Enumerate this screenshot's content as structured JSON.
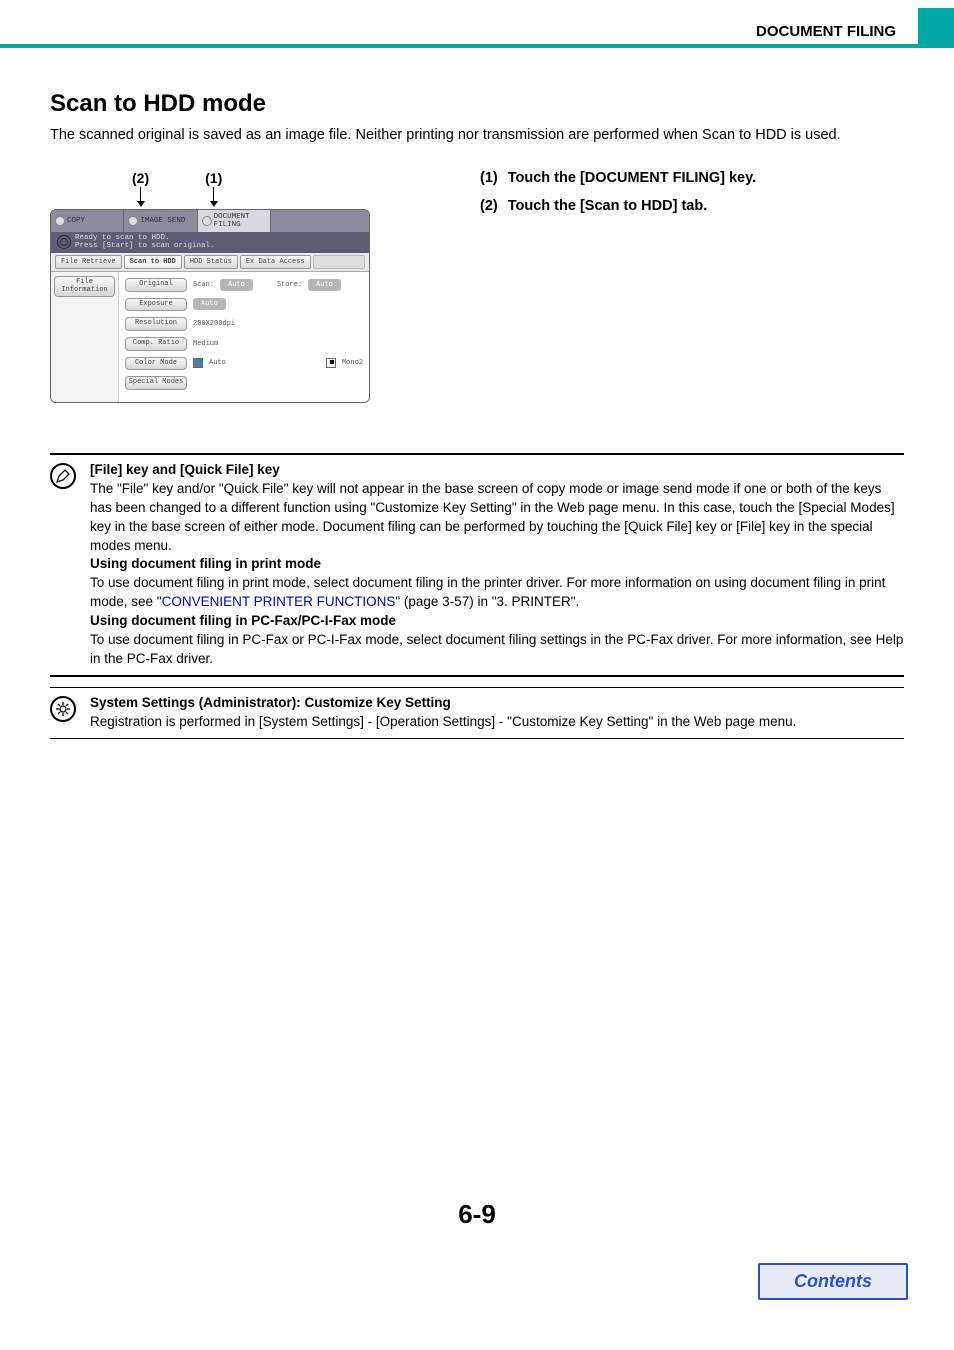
{
  "header": {
    "section_title": "DOCUMENT FILING"
  },
  "heading": "Scan to HDD mode",
  "lead": "The scanned original is saved as an image file. Neither printing nor transmission are performed when Scan to HDD is used.",
  "callouts": {
    "c1": "(1)",
    "c2": "(2)"
  },
  "panel": {
    "mode_tabs": {
      "copy": "COPY",
      "image_send": "IMAGE SEND",
      "doc_filing": "DOCUMENT FILING"
    },
    "status1": "Ready to scan to HDD.",
    "status2": "Press [Start] to scan original.",
    "sub_tabs": {
      "retrieve": "File Retrieve",
      "scan": "Scan to HDD",
      "hdd": "HDD Status",
      "ex": "Ex Data Access"
    },
    "side_btn": "File\nInformation",
    "rows": {
      "original": {
        "label": "Original",
        "scan": "Scan:",
        "scan_val": "Auto",
        "store": "Store:",
        "store_val": "Auto"
      },
      "exposure": {
        "label": "Exposure",
        "val": "Auto"
      },
      "resolution": {
        "label": "Resolution",
        "val": "200X200dpi"
      },
      "comp": {
        "label": "Comp. Ratio",
        "val": "Medium"
      },
      "color": {
        "label": "Color Mode",
        "val": "Auto",
        "mono": "Mono2"
      },
      "special": {
        "label": "Special Modes"
      }
    }
  },
  "steps": {
    "s1_num": "(1)",
    "s1_text": "Touch the [DOCUMENT FILING] key.",
    "s2_num": "(2)",
    "s2_text": "Touch the [Scan to HDD] tab."
  },
  "note1": {
    "h1": "[File] key and [Quick File] key",
    "p1": "The \"File\" key and/or \"Quick File\" key will not appear in the base screen of copy mode or image send mode if one or both of the keys has been changed to a different function using \"Customize Key Setting\" in the Web page menu. In this case, touch the [Special Modes] key in the base screen of either mode. Document filing can be performed by touching the [Quick File] key or [File] key in the special modes menu.",
    "h2": "Using document filing in print mode",
    "p2a": "To use document filing in print mode, select document filing in the printer driver. For more information on using document filing in print mode, see \"",
    "link": "CONVENIENT PRINTER FUNCTIONS",
    "p2b": "\" (page 3-57) in \"3. PRINTER\".",
    "h3": "Using document filing in PC-Fax/PC-I-Fax mode",
    "p3": "To use document filing in PC-Fax or PC-I-Fax mode, select document filing settings in the PC-Fax driver. For more information, see Help in the PC-Fax driver."
  },
  "note2": {
    "h": "System Settings (Administrator): Customize Key Setting",
    "p": "Registration is performed in [System Settings] - [Operation Settings] - \"Customize Key Setting\" in the Web page menu."
  },
  "page_number": "6-9",
  "contents_label": "Contents"
}
